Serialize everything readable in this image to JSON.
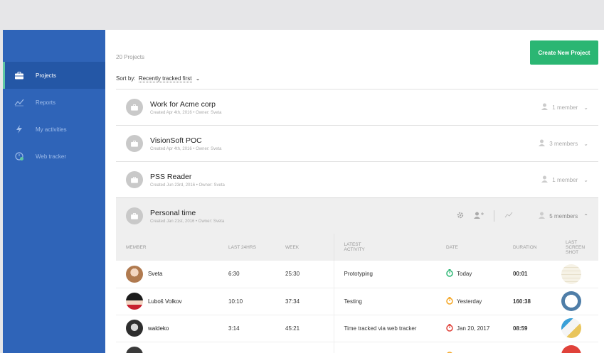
{
  "sidebar": {
    "items": [
      {
        "label": "Projects",
        "icon": "briefcase-icon",
        "active": true
      },
      {
        "label": "Reports",
        "icon": "chart-line-icon",
        "active": false
      },
      {
        "label": "My activities",
        "icon": "lightning-icon",
        "active": false
      },
      {
        "label": "Web tracker",
        "icon": "web-tracker-icon",
        "active": false
      }
    ]
  },
  "header": {
    "count_label": "20 Projects",
    "create_button": "Create New Project",
    "sort_prefix": "Sort by:",
    "sort_value": "Recently tracked first"
  },
  "projects": [
    {
      "name": "Work for Acme corp",
      "meta": "Created Apr 4th, 2016 • Owner: Sveta",
      "members": "1 member"
    },
    {
      "name": "VisionSoft POC",
      "meta": "Created Apr 4th, 2016 • Owner: Sveta",
      "members": "3 members"
    },
    {
      "name": "PSS Reader",
      "meta": "Created Jun 23rd, 2016 • Owner: Sveta",
      "members": "1 member"
    },
    {
      "name": "Personal time",
      "meta": "Created Jan 21st, 2016 • Owner: Sveta",
      "members": "5 members"
    }
  ],
  "table": {
    "headers": {
      "member": "MEMBER",
      "last24": "LAST 24HRS",
      "week": "WEEK",
      "latest_1": "LATEST",
      "latest_2": "ACTIVITY",
      "date": "DATE",
      "duration": "DURATION",
      "shot_1": "LAST",
      "shot_2": "SCREEN",
      "shot_3": "SHOT"
    },
    "rows": [
      {
        "member": "Sveta",
        "last24": "6:30",
        "week": "25:30",
        "activity": "Prototyping",
        "date": "Today",
        "date_color": "#2bb673",
        "duration": "00:01"
      },
      {
        "member": "Luboš Volkov",
        "last24": "10:10",
        "week": "37:34",
        "activity": "Testing",
        "date": "Yesterday",
        "date_color": "#f5a623",
        "duration": "160:38"
      },
      {
        "member": "waldeko",
        "last24": "3:14",
        "week": "45:21",
        "activity": "Time tracked via web tracker",
        "date": "Jan 20, 2017",
        "date_color": "#e0423a",
        "duration": "08:59"
      }
    ]
  },
  "colors": {
    "sidebar": "#2f64b8",
    "sidebar_active": "#2457a6",
    "accent_green": "#2bb673"
  }
}
